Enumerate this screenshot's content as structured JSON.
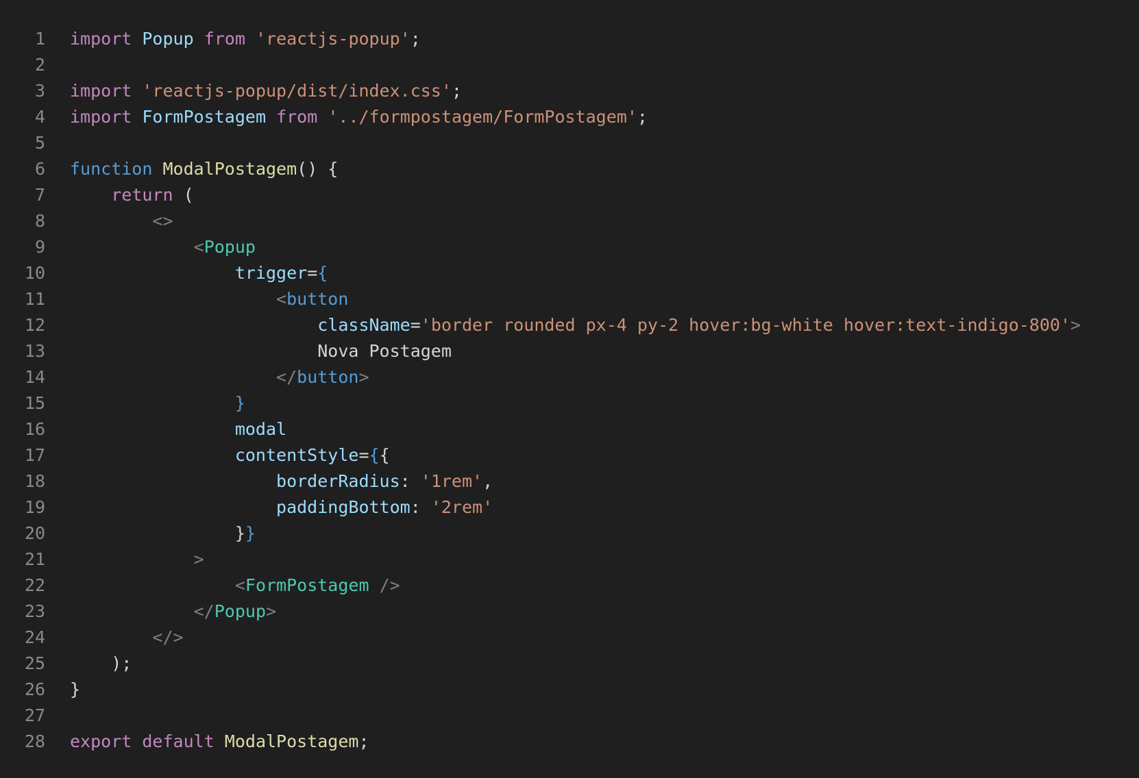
{
  "editor": {
    "theme": {
      "background": "#1f1f1f",
      "line_number": "#8a8a8a",
      "default": "#d4d4d4",
      "keyword": "#c586c0",
      "storage": "#569cd6",
      "variable": "#9cdcfe",
      "function": "#dcdcaa",
      "string": "#ce9178",
      "component_tag": "#4ec9b0",
      "html_tag": "#569cd6",
      "punctuation": "#808080"
    },
    "lines": [
      {
        "n": "1",
        "indent": 0,
        "tokens": [
          {
            "t": "import",
            "k": "keyword"
          },
          {
            "t": " ",
            "k": "text"
          },
          {
            "t": "Popup",
            "k": "var"
          },
          {
            "t": " ",
            "k": "text"
          },
          {
            "t": "from",
            "k": "keyword"
          },
          {
            "t": " ",
            "k": "text"
          },
          {
            "t": "'reactjs-popup'",
            "k": "string"
          },
          {
            "t": ";",
            "k": "text"
          }
        ]
      },
      {
        "n": "2",
        "indent": 0,
        "tokens": []
      },
      {
        "n": "3",
        "indent": 0,
        "tokens": [
          {
            "t": "import",
            "k": "keyword"
          },
          {
            "t": " ",
            "k": "text"
          },
          {
            "t": "'reactjs-popup/dist/index.css'",
            "k": "string"
          },
          {
            "t": ";",
            "k": "text"
          }
        ]
      },
      {
        "n": "4",
        "indent": 0,
        "tokens": [
          {
            "t": "import",
            "k": "keyword"
          },
          {
            "t": " ",
            "k": "text"
          },
          {
            "t": "FormPostagem",
            "k": "var"
          },
          {
            "t": " ",
            "k": "text"
          },
          {
            "t": "from",
            "k": "keyword"
          },
          {
            "t": " ",
            "k": "text"
          },
          {
            "t": "'../formpostagem/FormPostagem'",
            "k": "string"
          },
          {
            "t": ";",
            "k": "text"
          }
        ]
      },
      {
        "n": "5",
        "indent": 0,
        "tokens": []
      },
      {
        "n": "6",
        "indent": 0,
        "tokens": [
          {
            "t": "function",
            "k": "storage"
          },
          {
            "t": " ",
            "k": "text"
          },
          {
            "t": "ModalPostagem",
            "k": "func"
          },
          {
            "t": "() {",
            "k": "text"
          }
        ]
      },
      {
        "n": "7",
        "indent": 4,
        "tokens": [
          {
            "t": "return",
            "k": "keyword"
          },
          {
            "t": " (",
            "k": "text"
          }
        ]
      },
      {
        "n": "8",
        "indent": 8,
        "tokens": [
          {
            "t": "<>",
            "k": "punct"
          }
        ]
      },
      {
        "n": "9",
        "indent": 12,
        "tokens": [
          {
            "t": "<",
            "k": "punct"
          },
          {
            "t": "Popup",
            "k": "tag"
          }
        ]
      },
      {
        "n": "10",
        "indent": 16,
        "tokens": [
          {
            "t": "trigger",
            "k": "var"
          },
          {
            "t": "=",
            "k": "text"
          },
          {
            "t": "{",
            "k": "brace"
          }
        ]
      },
      {
        "n": "11",
        "indent": 20,
        "tokens": [
          {
            "t": "<",
            "k": "punct"
          },
          {
            "t": "button",
            "k": "html"
          }
        ]
      },
      {
        "n": "12",
        "indent": 24,
        "tokens": [
          {
            "t": "className",
            "k": "var"
          },
          {
            "t": "=",
            "k": "text"
          },
          {
            "t": "'border rounded px-4 py-2 hover:bg-white hover:text-indigo-800'",
            "k": "string"
          },
          {
            "t": ">",
            "k": "punct"
          }
        ]
      },
      {
        "n": "13",
        "indent": 24,
        "tokens": [
          {
            "t": "Nova Postagem",
            "k": "text"
          }
        ]
      },
      {
        "n": "14",
        "indent": 20,
        "tokens": [
          {
            "t": "</",
            "k": "punct"
          },
          {
            "t": "button",
            "k": "html"
          },
          {
            "t": ">",
            "k": "punct"
          }
        ]
      },
      {
        "n": "15",
        "indent": 16,
        "tokens": [
          {
            "t": "}",
            "k": "brace"
          }
        ]
      },
      {
        "n": "16",
        "indent": 16,
        "tokens": [
          {
            "t": "modal",
            "k": "var"
          }
        ]
      },
      {
        "n": "17",
        "indent": 16,
        "tokens": [
          {
            "t": "contentStyle",
            "k": "var"
          },
          {
            "t": "=",
            "k": "text"
          },
          {
            "t": "{",
            "k": "brace"
          },
          {
            "t": "{",
            "k": "text"
          }
        ]
      },
      {
        "n": "18",
        "indent": 20,
        "tokens": [
          {
            "t": "borderRadius",
            "k": "var"
          },
          {
            "t": ": ",
            "k": "text"
          },
          {
            "t": "'1rem'",
            "k": "string"
          },
          {
            "t": ",",
            "k": "text"
          }
        ]
      },
      {
        "n": "19",
        "indent": 20,
        "tokens": [
          {
            "t": "paddingBottom",
            "k": "var"
          },
          {
            "t": ": ",
            "k": "text"
          },
          {
            "t": "'2rem'",
            "k": "string"
          }
        ]
      },
      {
        "n": "20",
        "indent": 16,
        "tokens": [
          {
            "t": "}",
            "k": "text"
          },
          {
            "t": "}",
            "k": "brace"
          }
        ]
      },
      {
        "n": "21",
        "indent": 12,
        "tokens": [
          {
            "t": ">",
            "k": "punct"
          }
        ]
      },
      {
        "n": "22",
        "indent": 16,
        "tokens": [
          {
            "t": "<",
            "k": "punct"
          },
          {
            "t": "FormPostagem",
            "k": "tag"
          },
          {
            "t": " />",
            "k": "punct"
          }
        ]
      },
      {
        "n": "23",
        "indent": 12,
        "tokens": [
          {
            "t": "</",
            "k": "punct"
          },
          {
            "t": "Popup",
            "k": "tag"
          },
          {
            "t": ">",
            "k": "punct"
          }
        ]
      },
      {
        "n": "24",
        "indent": 8,
        "tokens": [
          {
            "t": "</>",
            "k": "punct"
          }
        ]
      },
      {
        "n": "25",
        "indent": 4,
        "tokens": [
          {
            "t": ");",
            "k": "text"
          }
        ]
      },
      {
        "n": "26",
        "indent": 0,
        "tokens": [
          {
            "t": "}",
            "k": "text"
          }
        ]
      },
      {
        "n": "27",
        "indent": 0,
        "tokens": []
      },
      {
        "n": "28",
        "indent": 0,
        "tokens": [
          {
            "t": "export",
            "k": "keyword"
          },
          {
            "t": " ",
            "k": "text"
          },
          {
            "t": "default",
            "k": "keyword"
          },
          {
            "t": " ",
            "k": "text"
          },
          {
            "t": "ModalPostagem",
            "k": "func"
          },
          {
            "t": ";",
            "k": "text"
          }
        ]
      }
    ]
  }
}
